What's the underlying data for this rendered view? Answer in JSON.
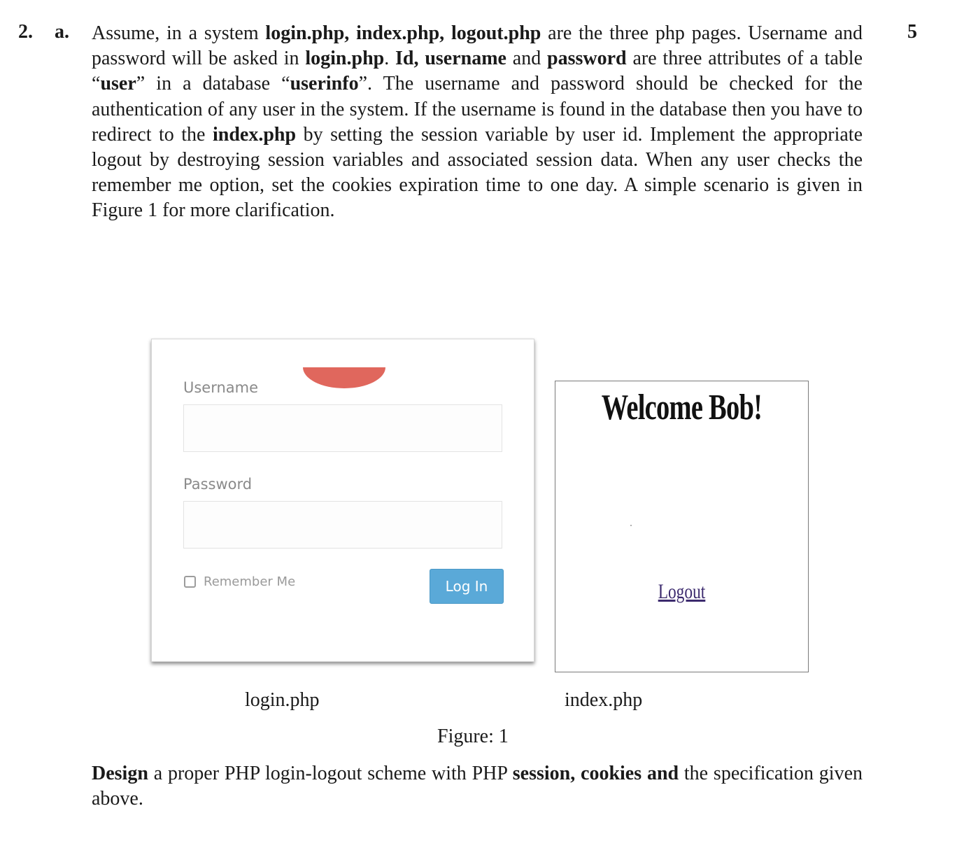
{
  "question": {
    "number": "2.",
    "part": "a.",
    "marks": "5",
    "paragraph_segments": [
      {
        "t": "Assume, in a system ",
        "b": false
      },
      {
        "t": "login.php, index.php, logout.php",
        "b": true
      },
      {
        "t": " are the three php pages. Username and password will be asked in ",
        "b": false
      },
      {
        "t": "login.php",
        "b": true
      },
      {
        "t": ". ",
        "b": false
      },
      {
        "t": "Id, username",
        "b": true
      },
      {
        "t": " and ",
        "b": false
      },
      {
        "t": "password",
        "b": true
      },
      {
        "t": " are three attributes of a table “",
        "b": false
      },
      {
        "t": "user",
        "b": true
      },
      {
        "t": "” in a database “",
        "b": false
      },
      {
        "t": "userinfo",
        "b": true
      },
      {
        "t": "”. The username and password should be checked for the authentication of any user in the system. If the username is found in the database then you have to redirect to the ",
        "b": false
      },
      {
        "t": "index.php",
        "b": true
      },
      {
        "t": " by setting the session variable by user id. Implement the appropriate logout by destroying session variables and associated session data. When any user checks the remember me option, set the cookies expiration time to one day. A simple scenario is given in Figure 1 for more clarification.",
        "b": false
      }
    ],
    "instruction_segments": [
      {
        "t": "Design",
        "b": true
      },
      {
        "t": " a proper PHP login-logout scheme with PHP ",
        "b": false
      },
      {
        "t": "session, cookies and",
        "b": true
      },
      {
        "t": " the specification given above.",
        "b": false
      }
    ]
  },
  "figure": {
    "login": {
      "username_label": "Username",
      "password_label": "Password",
      "remember_label": "Remember Me",
      "button_label": "Log In",
      "caption": "login.php"
    },
    "index": {
      "welcome_text": "Welcome Bob!",
      "logout_link": "Logout",
      "caption": "index.php"
    },
    "caption": "Figure: 1"
  }
}
